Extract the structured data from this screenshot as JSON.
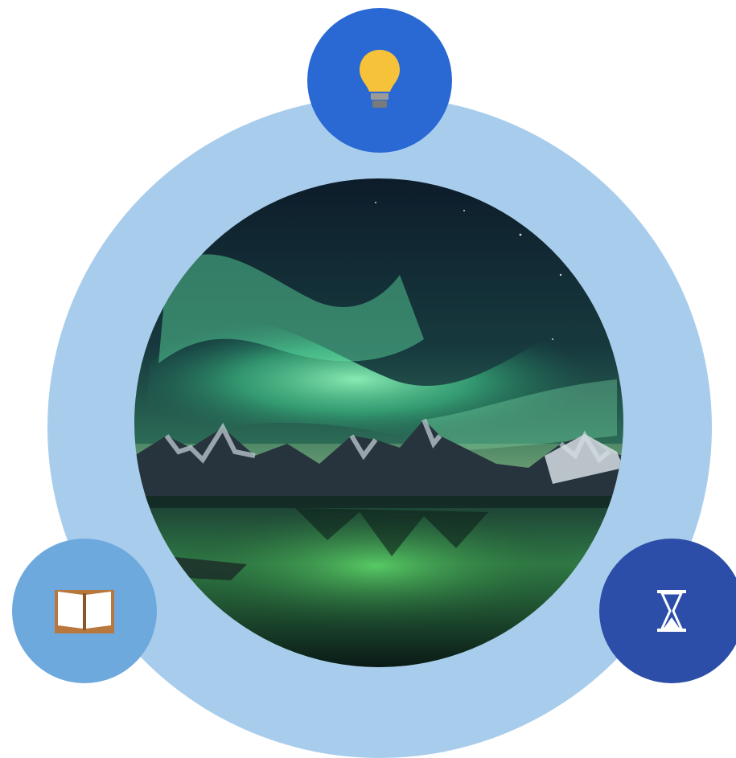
{
  "diagram": {
    "ring_color": "#a8cdec",
    "nodes": [
      {
        "id": "idea",
        "icon": "lightbulb-icon",
        "color": "#2a69d3"
      },
      {
        "id": "learning",
        "icon": "open-book-icon",
        "color": "#6ea9de"
      },
      {
        "id": "time",
        "icon": "hourglass-icon",
        "color": "#2c4ea8"
      }
    ],
    "center_image": "aurora-over-mountains-lake-photo"
  }
}
